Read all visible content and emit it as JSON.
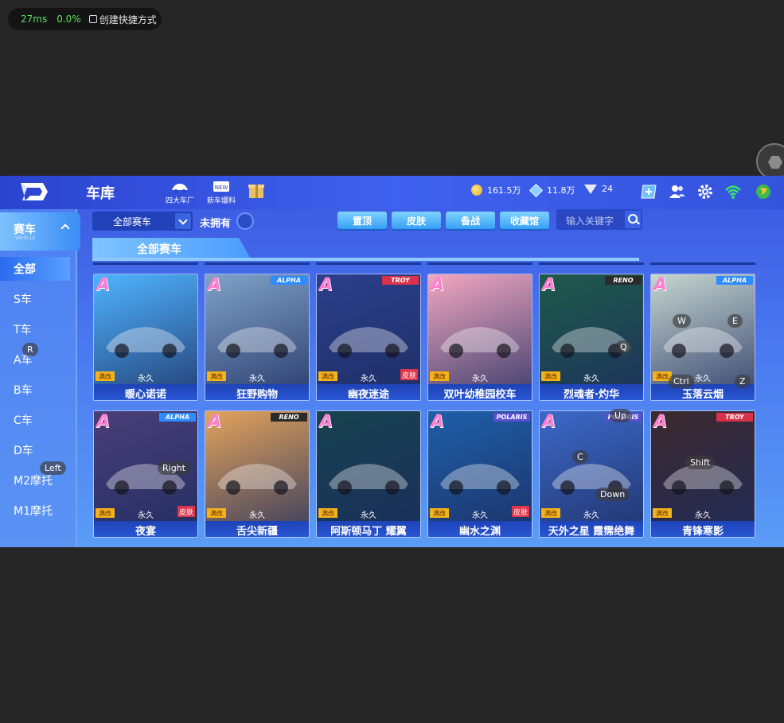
{
  "overlay": {
    "latency": "27ms",
    "loss": "0.0%",
    "shortcut_label": "创建快捷方式"
  },
  "header": {
    "title": "车库",
    "icons": [
      {
        "label": "四大车厂",
        "icon": "car-factory-icon"
      },
      {
        "label": "新车爆料",
        "icon": "new-car-icon"
      },
      {
        "label": "",
        "icon": "gift-icon"
      }
    ],
    "currency": {
      "coins": "161.5万",
      "crystals": "11.8万",
      "diamonds": "24"
    }
  },
  "sidebar": {
    "category": "赛车",
    "category_sub": "VEHICLE",
    "items": [
      "全部",
      "S车",
      "T车",
      "A车",
      "B车",
      "C车",
      "D车",
      "M2摩托",
      "M1摩托"
    ]
  },
  "filters": {
    "dropdown": "全部赛车",
    "not_owned": "未拥有",
    "tabs": [
      "置顶",
      "皮肤",
      "备战",
      "收藏馆"
    ],
    "search_placeholder": "输入关键字"
  },
  "section_title": "全部赛车",
  "cars": [
    {
      "rank": "A",
      "brand": "",
      "name": "暖心诺诺",
      "duration": "永久",
      "mod": "满改",
      "skin": "",
      "color": "#4fb4ff"
    },
    {
      "rank": "A",
      "brand": "ALPHA",
      "name": "狂野购物",
      "duration": "永久",
      "mod": "满改",
      "skin": "",
      "color": "#7fa2c8"
    },
    {
      "rank": "A",
      "brand": "TROY",
      "name": "幽夜迷途",
      "duration": "永久",
      "mod": "满改",
      "skin": "皮肤",
      "color": "#2b3f8c"
    },
    {
      "rank": "A",
      "brand": "",
      "name": "双叶幼稚园校车",
      "duration": "永久",
      "mod": "满改",
      "skin": "",
      "color": "#f2a7c0"
    },
    {
      "rank": "A",
      "brand": "RENO",
      "name": "烈魂者·灼华",
      "duration": "永久",
      "mod": "满改",
      "skin": "",
      "color": "#1f5a4a"
    },
    {
      "rank": "A",
      "brand": "ALPHA",
      "name": "玉落云烟",
      "duration": "永久",
      "mod": "满改",
      "skin": "",
      "color": "#c6d6cf"
    },
    {
      "rank": "A",
      "brand": "ALPHA",
      "name": "夜宴",
      "duration": "永久",
      "mod": "满改",
      "skin": "皮肤",
      "color": "#4a3e78"
    },
    {
      "rank": "A",
      "brand": "RENO",
      "name": "舌尖新疆",
      "duration": "永久",
      "mod": "满改",
      "skin": "",
      "color": "#e3a35c"
    },
    {
      "rank": "A",
      "brand": "",
      "name": "阿斯顿马丁 耀翼",
      "duration": "永久",
      "mod": "满改",
      "skin": "",
      "color": "#17424f"
    },
    {
      "rank": "A",
      "brand": "POLARIS",
      "name": "幽水之渊",
      "duration": "永久",
      "mod": "满改",
      "skin": "皮肤",
      "color": "#1e5fa8"
    },
    {
      "rank": "A",
      "brand": "POLARIS",
      "name": "天外之星 霞霈绝舞",
      "duration": "永久",
      "mod": "满改",
      "skin": "",
      "color": "#3c69c8"
    },
    {
      "rank": "A",
      "brand": "TROY",
      "name": "青锋寒影",
      "duration": "永久",
      "mod": "满改",
      "skin": "",
      "color": "#3c2a2e"
    }
  ],
  "key_hints": [
    "W",
    "E",
    "Q",
    "Ctrl",
    "Z",
    "R",
    "Left",
    "Right",
    "Up",
    "C",
    "Down",
    "Shift"
  ]
}
